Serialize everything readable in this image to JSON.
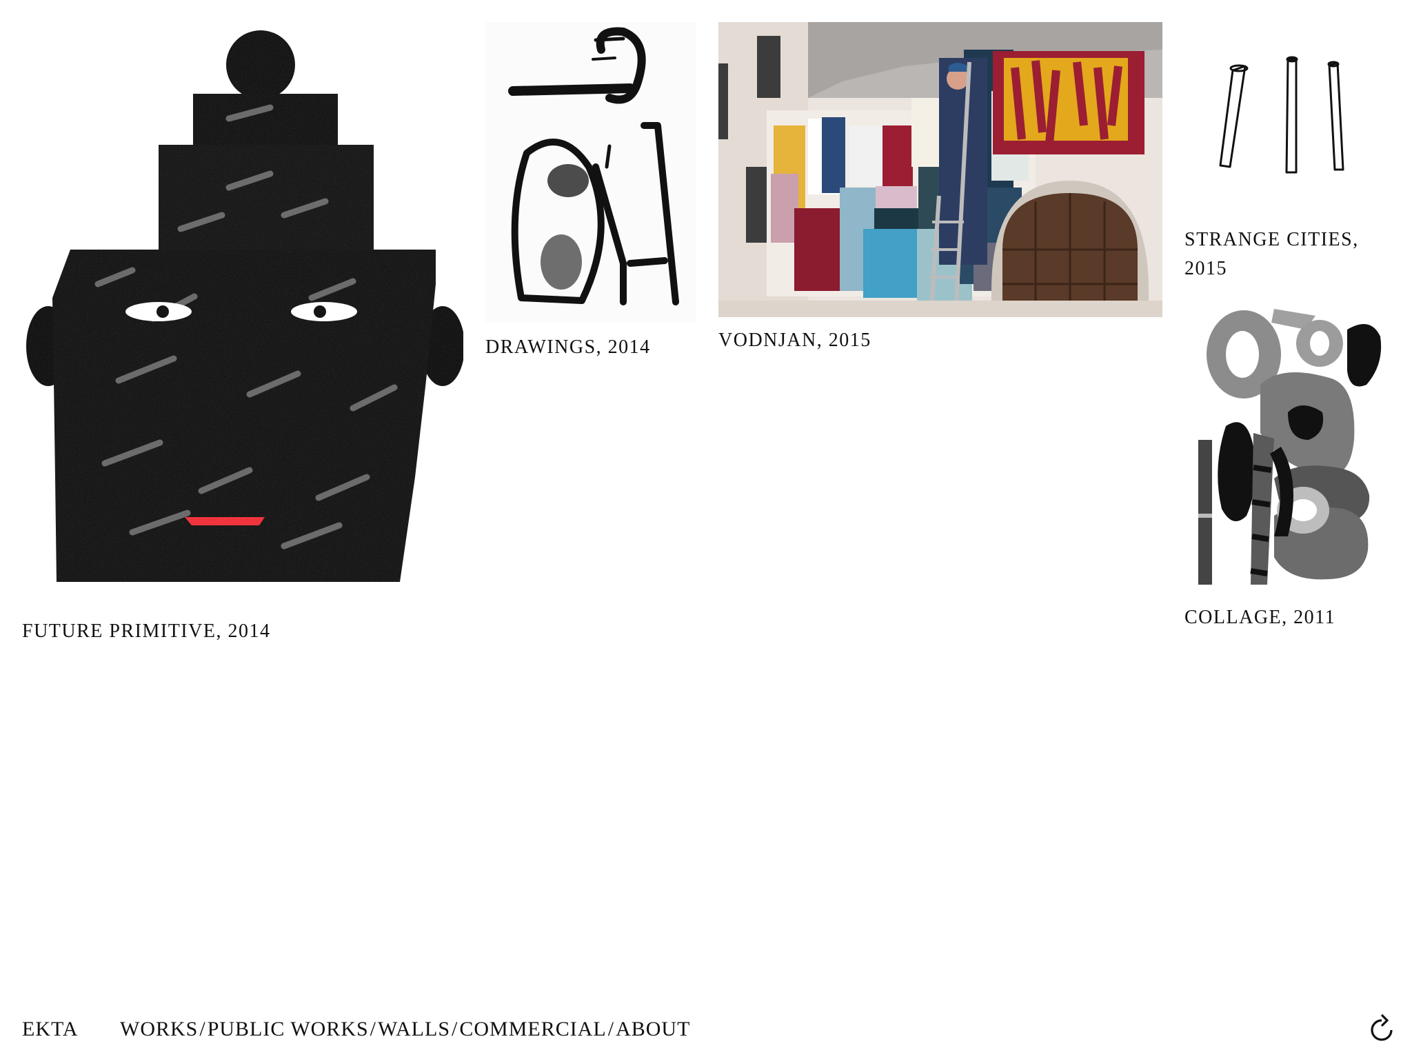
{
  "works": [
    {
      "title": "FUTURE PRIMITIVE, 2014"
    },
    {
      "title": "DRAWINGS, 2014"
    },
    {
      "title": "VODNJAN, 2015"
    },
    {
      "title_line1": "STRANGE CITIES,",
      "title_line2": "2015"
    },
    {
      "title": "COLLAGE, 2011"
    }
  ],
  "footer": {
    "brand": "EKTA",
    "nav": [
      "WORKS",
      "PUBLIC WORKS",
      "WALLS",
      "COMMERCIAL",
      "ABOUT"
    ],
    "separator": "/"
  },
  "icons": {
    "reload": "reload-icon"
  },
  "colors": {
    "background": "#ffffff",
    "text": "#111111",
    "accent_lip": "#f0303a"
  }
}
